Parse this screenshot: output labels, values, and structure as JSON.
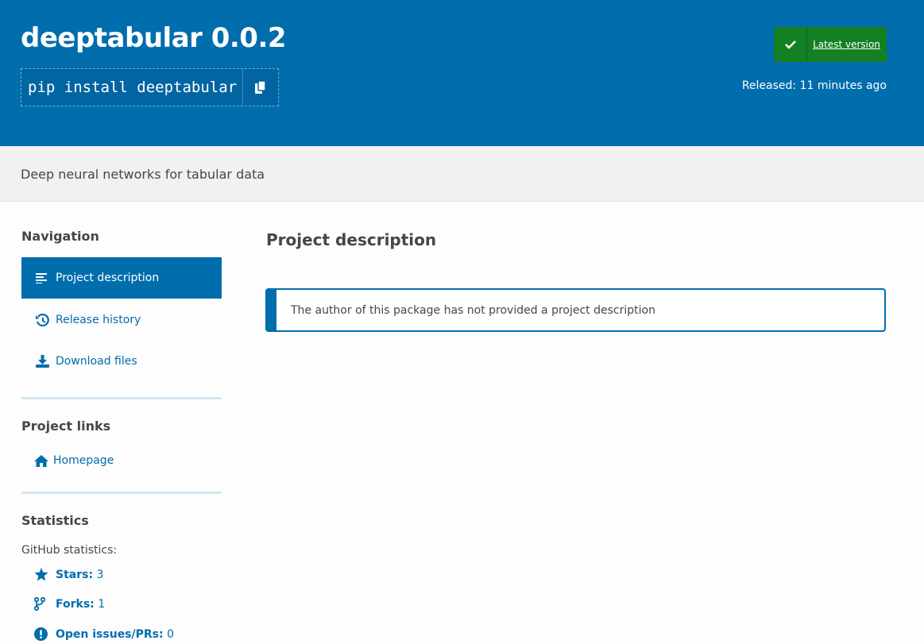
{
  "header": {
    "title": "deeptabular 0.0.2",
    "pip_command": "pip install deeptabular",
    "latest_label": "Latest version",
    "released_label": "Released:",
    "released_value": "11 minutes ago",
    "colors": {
      "banner": "#006dad",
      "latest_badge": "#148024"
    }
  },
  "summary": "Deep neural networks for tabular data",
  "sidebar": {
    "navigation_heading": "Navigation",
    "nav_items": [
      {
        "label": "Project description",
        "icon": "align-left-icon",
        "active": true
      },
      {
        "label": "Release history",
        "icon": "history-icon",
        "active": false
      },
      {
        "label": "Download files",
        "icon": "download-icon",
        "active": false
      }
    ],
    "project_links_heading": "Project links",
    "project_links": [
      {
        "label": "Homepage",
        "icon": "home-icon"
      }
    ],
    "statistics_heading": "Statistics",
    "github_label": "GitHub statistics:",
    "stats": [
      {
        "label": "Stars:",
        "value": "3",
        "icon": "star-icon"
      },
      {
        "label": "Forks:",
        "value": "1",
        "icon": "fork-icon"
      },
      {
        "label": "Open issues/PRs:",
        "value": "0",
        "icon": "exclamation-icon"
      }
    ]
  },
  "main": {
    "heading": "Project description",
    "callout": "The author of this package has not provided a project description"
  }
}
